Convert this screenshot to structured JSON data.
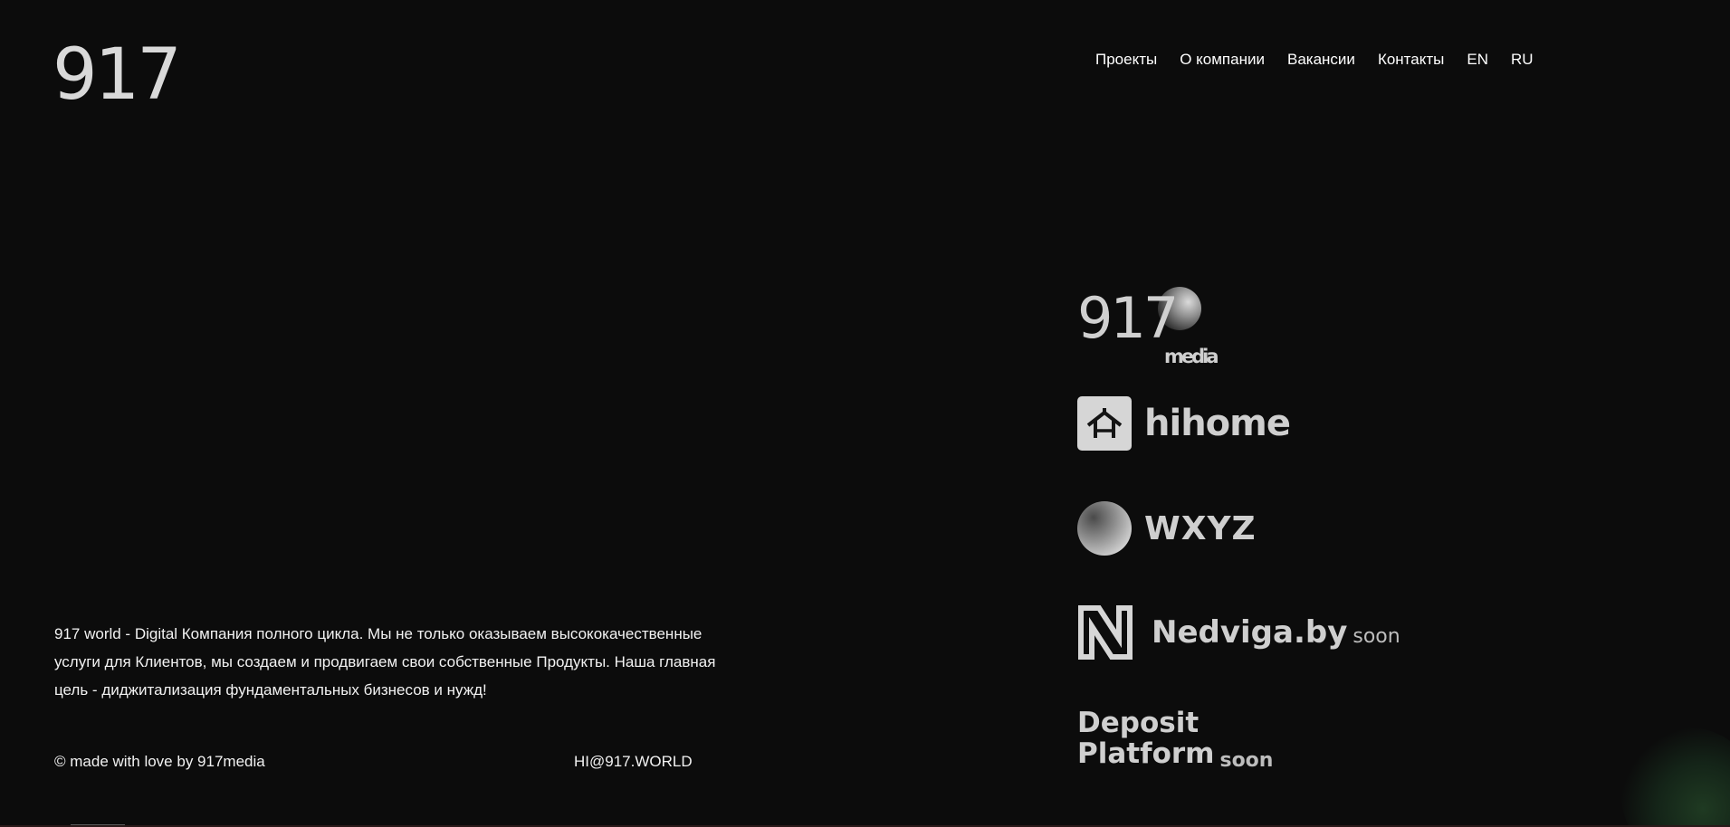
{
  "header": {
    "logo": "917",
    "nav": [
      {
        "label": "Проекты"
      },
      {
        "label": "О компании"
      },
      {
        "label": "Вакансии"
      },
      {
        "label": "Контакты"
      },
      {
        "label": "EN"
      },
      {
        "label": "RU"
      }
    ]
  },
  "main": {
    "description": "917 world - Digital Компания полного цикла. Мы не только оказываем высококачественные услуги для Клиентов, мы создаем и продвигаем свои собственные Продукты. Наша главная цель - диджитализация фундаментальных бизнесов и нужд!"
  },
  "brands": {
    "media": {
      "number": "917",
      "word": "media"
    },
    "hihome": {
      "word": "hihome"
    },
    "wxyz": {
      "word": "WXYZ"
    },
    "nedviga": {
      "word": "Nedviga.by",
      "soon": "soon"
    },
    "deposit": {
      "line1": "Deposit",
      "line2": "Platform",
      "soon": "soon"
    }
  },
  "footer": {
    "copyright": "© made with love by 917media",
    "email": "HI@917.WORLD"
  },
  "colors": {
    "background": "#0c0c0c",
    "text": "#ffffff",
    "logo_gray": "#cfcfcf"
  }
}
